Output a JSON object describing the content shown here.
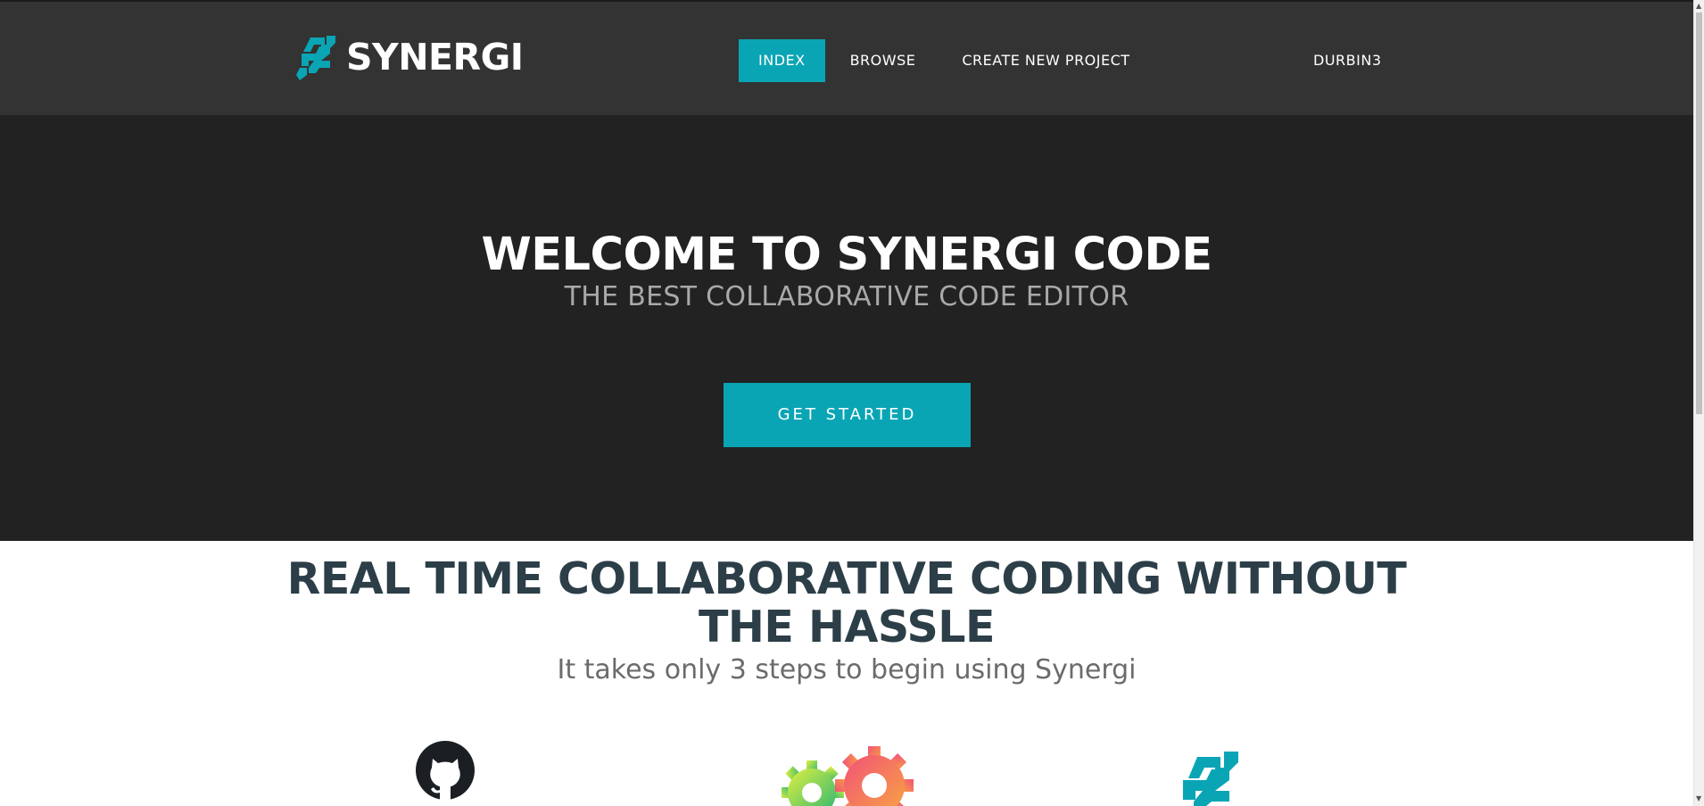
{
  "brand": {
    "name": "SYNERGI",
    "accent": "#0aa5b5"
  },
  "nav": {
    "items": [
      "INDEX",
      "BROWSE",
      "CREATE NEW PROJECT"
    ],
    "active": 0,
    "user": "DURBIN3"
  },
  "hero": {
    "title": "WELCOME TO SYNERGI CODE",
    "subtitle": "THE BEST COLLABORATIVE CODE EDITOR",
    "cta_label": "GET STARTED"
  },
  "features": {
    "headline_line1": "REAL TIME COLLABORATIVE CODING WITHOUT",
    "headline_line2": "THE HASSLE",
    "subline": "It takes only 3 steps to begin using Synergi",
    "steps": [
      {
        "icon": "github-icon"
      },
      {
        "icon": "gears-icon"
      },
      {
        "icon": "synergi-logo-icon"
      }
    ]
  },
  "scrollbar": {
    "up": "▲",
    "down": "▼"
  }
}
